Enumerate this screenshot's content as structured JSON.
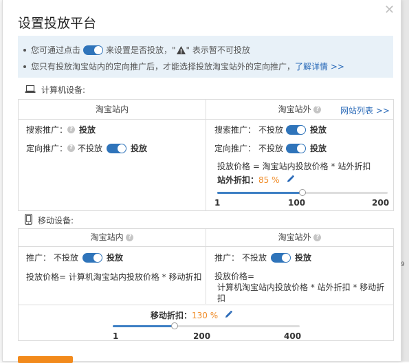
{
  "dialog": {
    "title": "设置投放平台",
    "close_icon": "close-icon"
  },
  "info": {
    "line1_pre": "您可通过点击",
    "line1_mid": "来设置是否投放，\"",
    "line1_post": "\" 表示暂不可投放",
    "line2_text": "您只有投放淘宝站内的定向推广后，才能选择投放淘宝站外的定向推广，",
    "line2_link": "了解详情 >>"
  },
  "computer": {
    "label": "计算机设备:",
    "icon": "laptop-icon",
    "inside": {
      "header": "淘宝站内",
      "search_label": "搜索推广：",
      "search_value": "投放",
      "targeted_label": "定向推广：",
      "targeted_off": "不投放",
      "targeted_on": "投放"
    },
    "outside": {
      "header": "淘宝站外",
      "site_list_link": "网站列表 >>",
      "search_label": "搜索推广：",
      "search_off": "不投放",
      "search_on": "投放",
      "targeted_label": "定向推广：",
      "targeted_off": "不投放",
      "targeted_on": "投放",
      "price_formula": "投放价格 = 淘宝站内投放价格 * 站外折扣",
      "discount_label": "站外折扣：",
      "discount_value": "85 %",
      "slider": {
        "min_label": "1",
        "mid_label": "100",
        "max_label": "200",
        "value_fraction": 0.5
      }
    }
  },
  "mobile": {
    "label": "移动设备:",
    "icon": "phone-icon",
    "inside": {
      "header": "淘宝站内",
      "promo_label": "推广：",
      "promo_off": "不投放",
      "promo_on": "投放",
      "price_formula": "投放价格= 计算机淘宝站内投放价格 * 移动折扣"
    },
    "outside": {
      "header": "淘宝站外",
      "promo_label": "推广：",
      "promo_off": "不投放",
      "promo_on": "投放",
      "price_line1": "投放价格=",
      "price_line2": "计算机淘宝站内投放价格 * 站外折扣 * 移动折",
      "price_line3": "扣"
    },
    "discount": {
      "label": "移动折扣：",
      "value": "130 %",
      "slider": {
        "min_label": "1",
        "mid_label": "200",
        "max_label": "400",
        "value_fraction": 0.33
      }
    }
  },
  "colors": {
    "toggle": "#2f74ba",
    "accent_orange": "#f08c28",
    "link": "#2a6ab8",
    "info_bg": "#e8f1f8"
  }
}
